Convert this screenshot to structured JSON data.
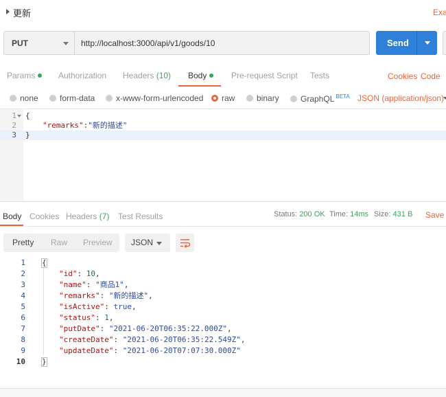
{
  "titlebar": {
    "title": "更新",
    "examples_label": "Exa"
  },
  "request": {
    "method": "PUT",
    "url": "http://localhost:3000/api/v1/goods/10",
    "send_label": "Send"
  },
  "request_tabs": {
    "params": "Params",
    "authorization": "Authorization",
    "headers": "Headers",
    "headers_count": "(10)",
    "body": "Body",
    "prerequest": "Pre-request Script",
    "tests": "Tests",
    "cookies": "Cookies",
    "code": "Code",
    "active": "Body"
  },
  "body_options": {
    "none": "none",
    "form_data": "form-data",
    "urlencoded": "x-www-form-urlencoded",
    "raw": "raw",
    "binary": "binary",
    "graphql": "GraphQL",
    "graphql_badge": "BETA",
    "content_type": "JSON (application/json)",
    "selected": "raw"
  },
  "request_editor": {
    "lines": [
      {
        "n": "1",
        "code": "{"
      },
      {
        "n": "2",
        "key": "\"remarks\"",
        "sep": ":",
        "value": "\"新的描述\""
      },
      {
        "n": "3",
        "code": "}"
      }
    ]
  },
  "response_tabs": {
    "body": "Body",
    "cookies": "Cookies",
    "headers": "Headers",
    "headers_count": "(7)",
    "test_results": "Test Results",
    "active": "Body"
  },
  "response_status": {
    "status_label": "Status:",
    "status_value": "200 OK",
    "time_label": "Time:",
    "time_value": "14ms",
    "size_label": "Size:",
    "size_value": "431 B",
    "save_label": "Save R"
  },
  "view_controls": {
    "pretty": "Pretty",
    "raw": "Raw",
    "preview": "Preview",
    "format": "JSON",
    "selected": "Pretty"
  },
  "response_body": {
    "lines": [
      {
        "n": "1",
        "text": "{"
      },
      {
        "n": "2",
        "key": "\"id\"",
        "value": "10",
        "type": "num",
        "comma": ","
      },
      {
        "n": "3",
        "key": "\"name\"",
        "value": "\"商品1\"",
        "type": "str",
        "comma": ","
      },
      {
        "n": "4",
        "key": "\"remarks\"",
        "value": "\"新的描述\"",
        "type": "str",
        "comma": ","
      },
      {
        "n": "5",
        "key": "\"isActive\"",
        "value": "true",
        "type": "bool",
        "comma": ","
      },
      {
        "n": "6",
        "key": "\"status\"",
        "value": "1",
        "type": "num",
        "comma": ","
      },
      {
        "n": "7",
        "key": "\"putDate\"",
        "value": "\"2021-06-20T06:35:22.000Z\"",
        "type": "str",
        "comma": ","
      },
      {
        "n": "8",
        "key": "\"createDate\"",
        "value": "\"2021-06-20T06:35:22.549Z\"",
        "type": "str",
        "comma": ","
      },
      {
        "n": "9",
        "key": "\"updateDate\"",
        "value": "\"2021-06-20T07:07:30.000Z\"",
        "type": "str",
        "comma": ""
      },
      {
        "n": "10",
        "text": "}"
      }
    ]
  },
  "colors": {
    "accent": "#e8643b",
    "primary_button": "#2f80d9",
    "success": "#3aa35c"
  }
}
